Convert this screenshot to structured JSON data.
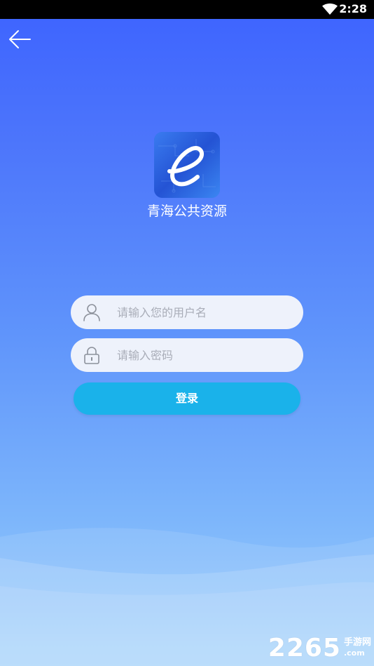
{
  "status_bar": {
    "time": "2:28",
    "wifi_icon": "wifi-icon"
  },
  "header": {
    "back_icon": "arrow-left-icon"
  },
  "app": {
    "logo_letter": "e",
    "name": "青海公共资源"
  },
  "form": {
    "username": {
      "icon": "user-icon",
      "placeholder": "请输入您的用户名",
      "value": ""
    },
    "password": {
      "icon": "lock-icon",
      "placeholder": "请输入密码",
      "value": ""
    },
    "login_label": "登录"
  },
  "watermark": {
    "number": "2265",
    "text": "手游网",
    "domain": ".com"
  },
  "colors": {
    "background_top": "#3d63ff",
    "background_bottom": "#9fd0fb",
    "button": "#1ab2ea",
    "input_bg": "#eef2fb",
    "placeholder": "#a9adb8"
  }
}
